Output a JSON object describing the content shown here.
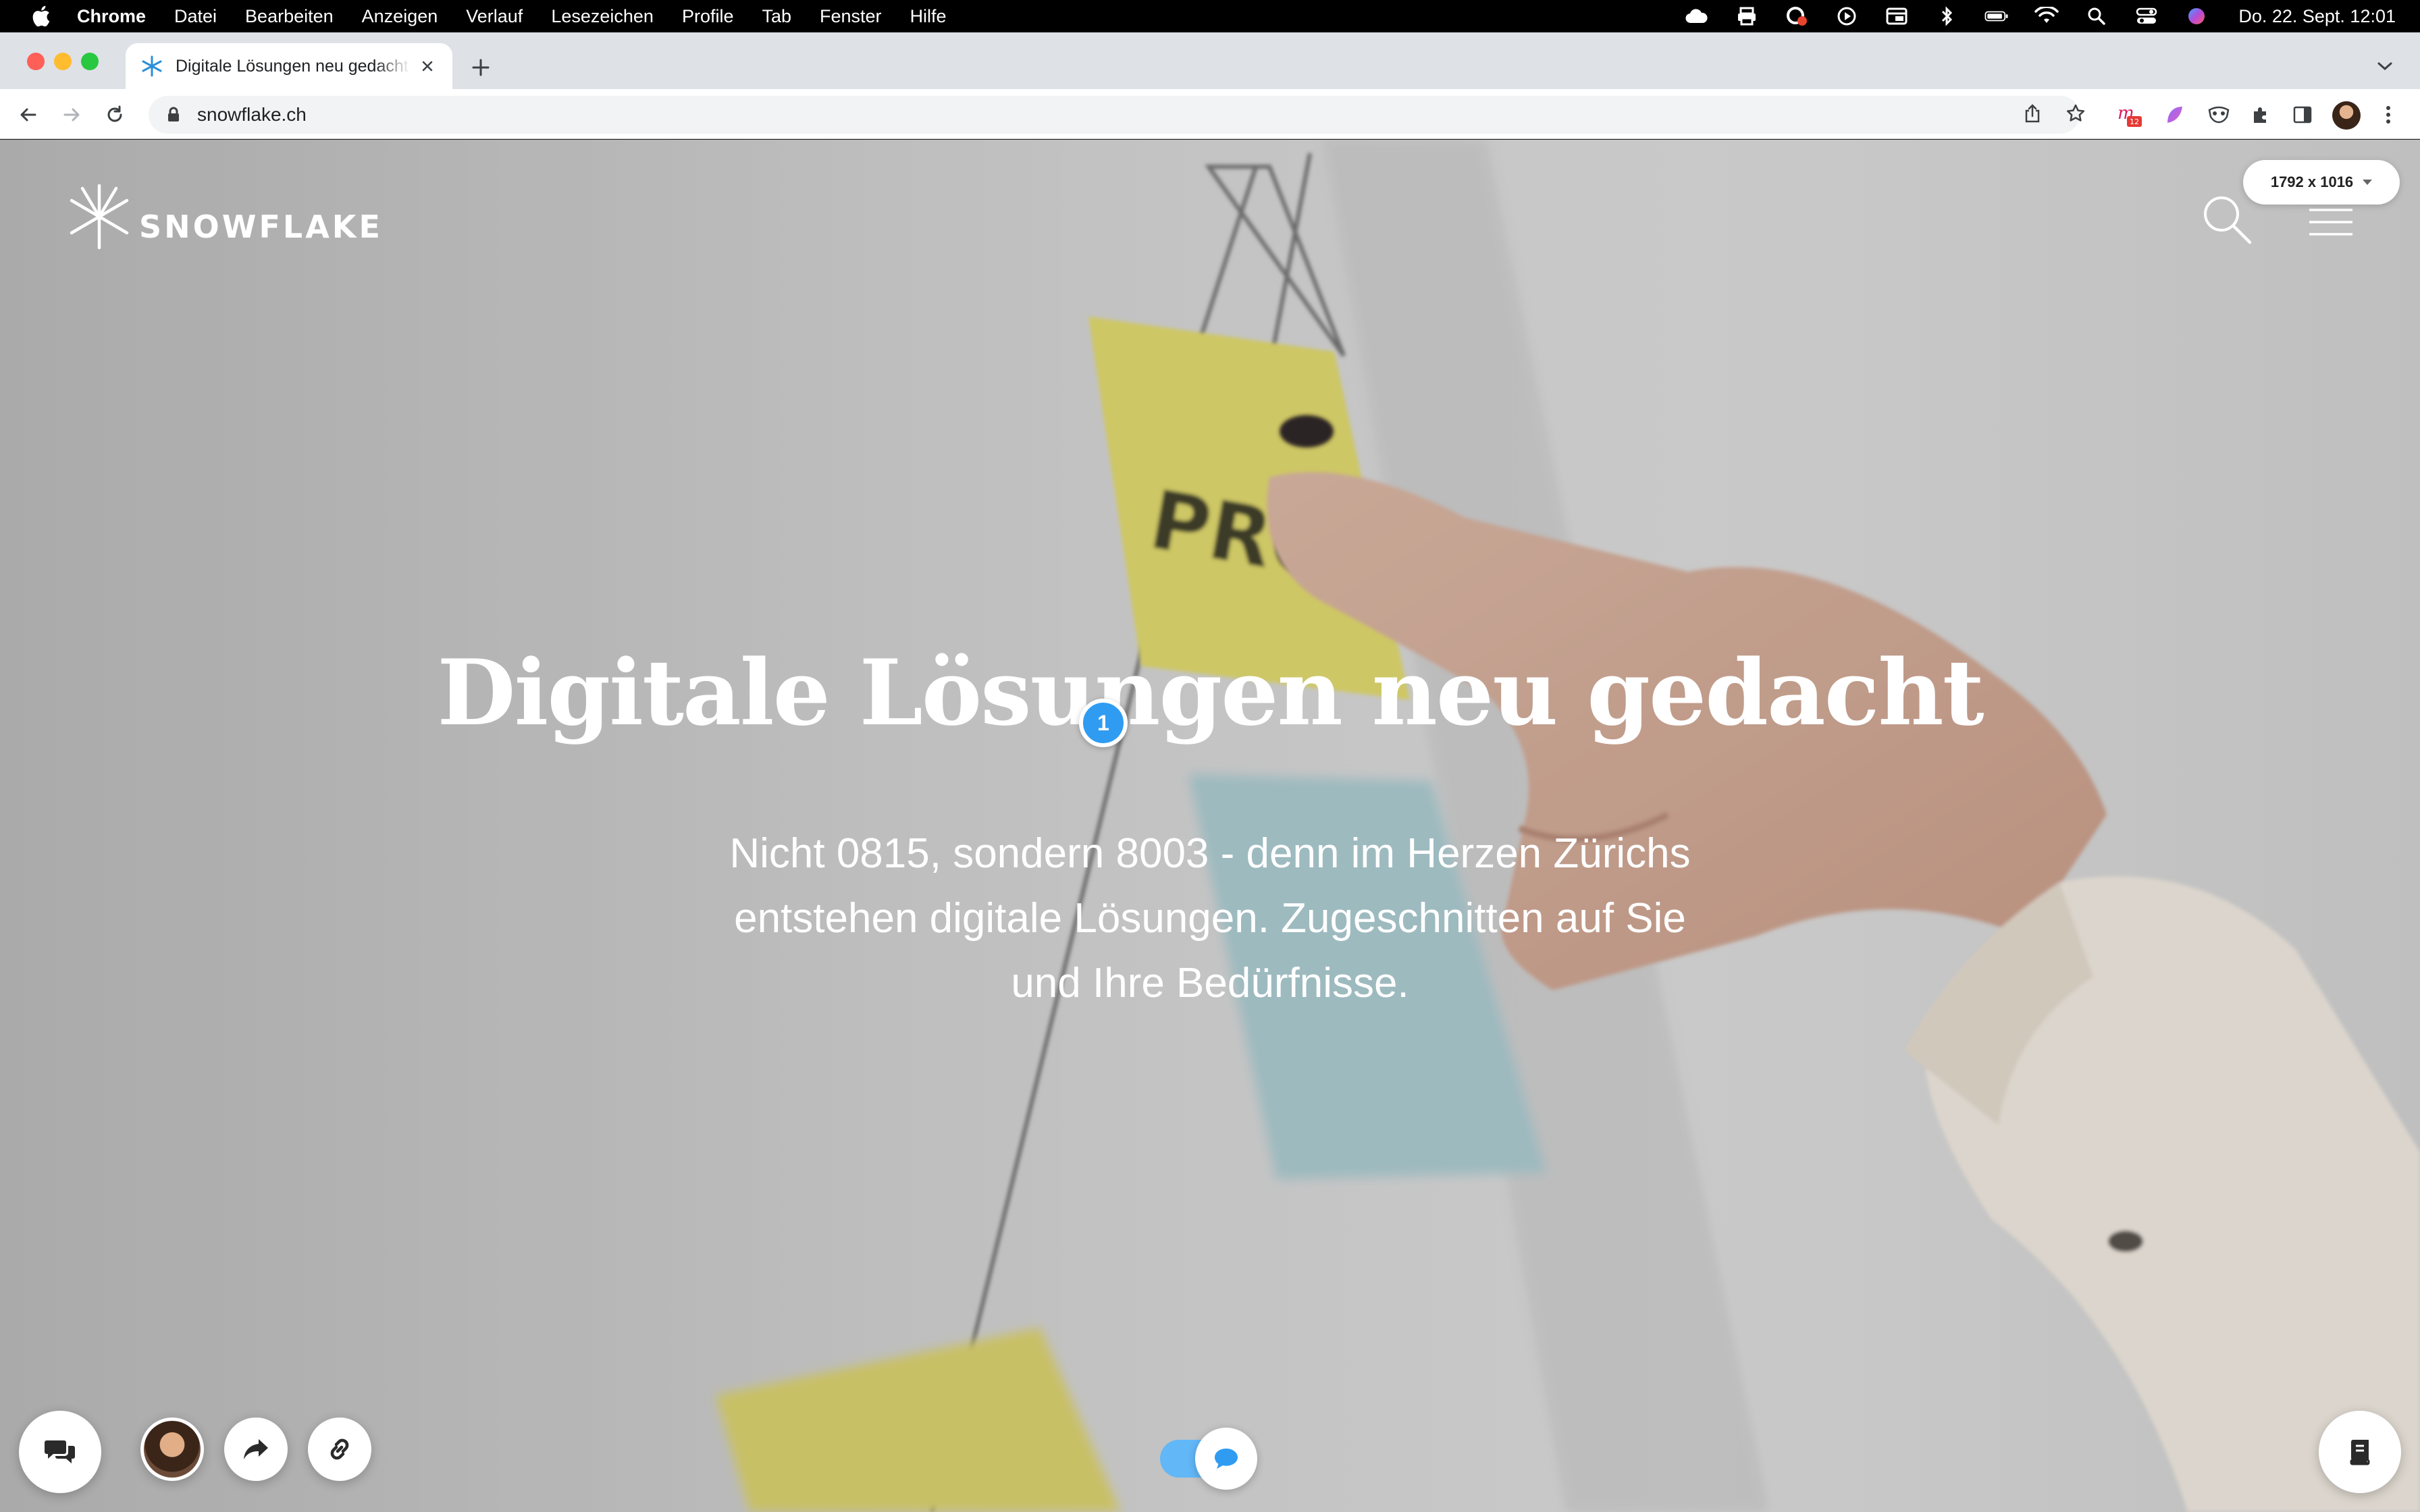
{
  "menubar": {
    "app": "Chrome",
    "items": [
      "Datei",
      "Bearbeiten",
      "Anzeigen",
      "Verlauf",
      "Lesezeichen",
      "Profile",
      "Tab",
      "Fenster",
      "Hilfe"
    ],
    "clock": "Do. 22. Sept.  12:01"
  },
  "browser": {
    "tab_title": "Digitale Lösungen neu gedacht",
    "url": "snowflake.ch",
    "extension_badge": "12"
  },
  "page": {
    "logo_text": "SNOWFLAKE",
    "viewport_size": "1792 x 1016",
    "hero_title": "Digitale Lösungen neu gedacht",
    "hero_subtitle": "Nicht 0815, sondern 8003 - denn im Herzen Zürichs entstehen digitale Lösungen. Zugeschnitten auf Sie und Ihre Bedürfnisse.",
    "pin_number": "1"
  },
  "colors": {
    "accent_blue": "#2f9cf2",
    "toggle_blue": "#62b7f7",
    "traffic_red": "#fe5f57",
    "traffic_yellow": "#febc2e",
    "traffic_green": "#28c840"
  },
  "icons": {
    "chat": "chat-bubbles-icon",
    "share": "share-arrow-icon",
    "link": "link-icon",
    "notes": "notebook-icon",
    "search": "search-icon",
    "menu": "hamburger-menu-icon"
  }
}
